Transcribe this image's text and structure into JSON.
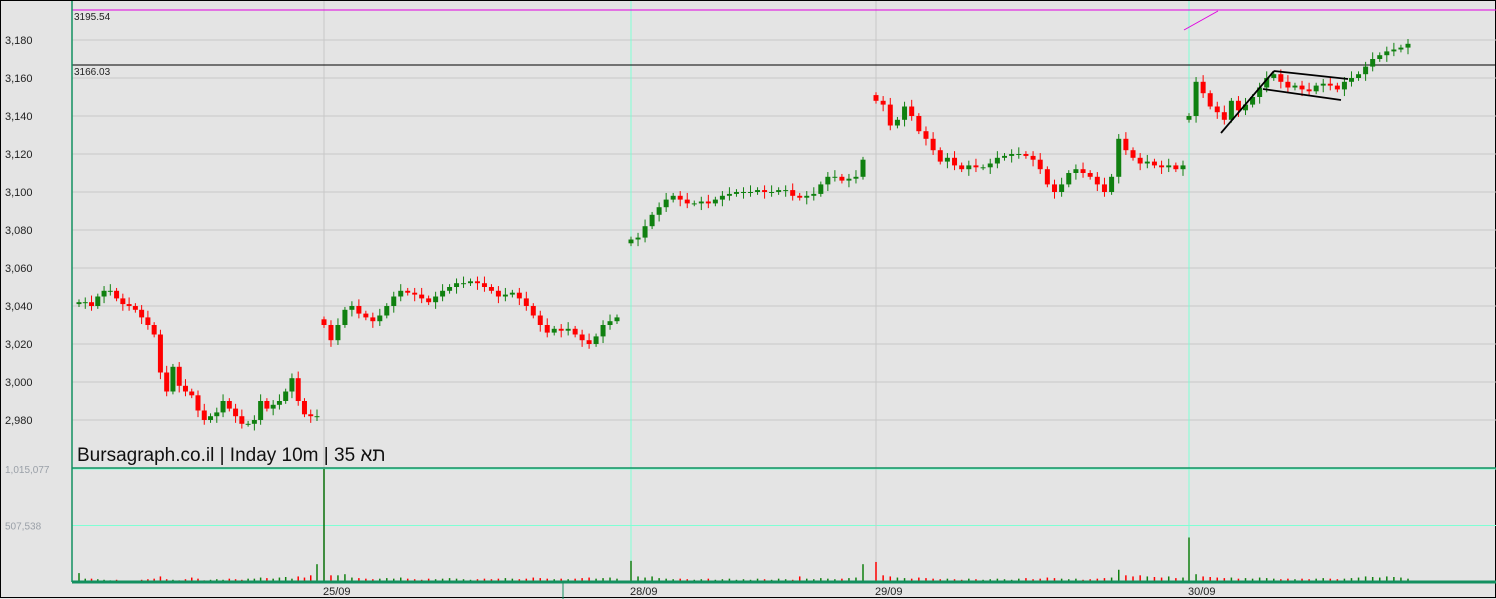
{
  "chart_data": {
    "type": "candlestick",
    "title": "Bursagraph.co.il | Inday 10m | 35 תא",
    "y_ticks": [
      2980,
      3000,
      3020,
      3040,
      3060,
      3080,
      3100,
      3120,
      3140,
      3160,
      3180
    ],
    "y_tick_labels": [
      "2,980",
      "3,000",
      "3,020",
      "3,040",
      "3,060",
      "3,080",
      "3,100",
      "3,120",
      "3,140",
      "3,160",
      "3,180"
    ],
    "ylim": [
      2970,
      3198
    ],
    "levels": [
      {
        "value": 3195.54,
        "label": "3195.54",
        "color": "#e000e0"
      },
      {
        "value": 3166.03,
        "label": "3166.03",
        "color": "#000000"
      }
    ],
    "volume_ticks": [
      {
        "value": 1015077,
        "label": "1,015,077"
      },
      {
        "value": 507538,
        "label": "507,538"
      }
    ],
    "volume_max": 1015077,
    "colors": {
      "up": "#108010",
      "down": "#ff0000",
      "grid": "#c8c8c8",
      "cyan": "#7fffd4",
      "axis": "#139060"
    },
    "days": [
      {
        "label": "",
        "closes": [
          3042,
          3042,
          3040,
          3045,
          3048,
          3048,
          3044,
          3041,
          3040,
          3038,
          3034,
          3030,
          3025,
          3005,
          2995,
          3008,
          2998,
          2995,
          2993,
          2985,
          2980,
          2982,
          2984,
          2990,
          2986,
          2982,
          2978,
          2978,
          2980,
          2990,
          2986,
          2988,
          2990,
          2995,
          3002,
          2990,
          2983,
          2982,
          2982
        ],
        "volumes": [
          80000,
          30000,
          30000,
          25000,
          20000,
          15000,
          20000,
          12000,
          10000,
          12000,
          20000,
          25000,
          30000,
          50000,
          25000,
          20000,
          15000,
          25000,
          40000,
          30000,
          15000,
          20000,
          25000,
          20000,
          30000,
          25000,
          20000,
          30000,
          30000,
          40000,
          35000,
          30000,
          40000,
          45000,
          30000,
          50000,
          40000,
          60000,
          160000
        ]
      },
      {
        "label": "25/09",
        "closes": [
          3030,
          3022,
          3030,
          3038,
          3040,
          3036,
          3034,
          3032,
          3035,
          3040,
          3045,
          3048,
          3047,
          3046,
          3044,
          3042,
          3045,
          3048,
          3050,
          3052,
          3052,
          3053,
          3052,
          3050,
          3048,
          3045,
          3046,
          3047,
          3044,
          3040,
          3035,
          3030,
          3026,
          3028,
          3027,
          3028,
          3025,
          3022,
          3020,
          3024,
          3030,
          3032,
          3034
        ],
        "volumes": [
          1015077,
          60000,
          60000,
          70000,
          40000,
          35000,
          30000,
          25000,
          30000,
          35000,
          30000,
          40000,
          30000,
          25000,
          20000,
          30000,
          25000,
          30000,
          35000,
          30000,
          25000,
          20000,
          25000,
          30000,
          25000,
          30000,
          35000,
          30000,
          25000,
          30000,
          40000,
          35000,
          30000,
          25000,
          30000,
          25000,
          30000,
          35000,
          40000,
          30000,
          35000,
          40000,
          30000
        ]
      },
      {
        "label": "28/09",
        "closes": [
          3075,
          3076,
          3082,
          3088,
          3092,
          3096,
          3098,
          3096,
          3094,
          3094,
          3095,
          3094,
          3096,
          3098,
          3099,
          3100,
          3100,
          3100,
          3101,
          3100,
          3100,
          3101,
          3101,
          3098,
          3097,
          3098,
          3099,
          3104,
          3108,
          3108,
          3106,
          3107,
          3108,
          3117
        ],
        "volumes": [
          190000,
          50000,
          40000,
          50000,
          35000,
          30000,
          25000,
          30000,
          25000,
          20000,
          25000,
          30000,
          20000,
          25000,
          30000,
          20000,
          25000,
          20000,
          30000,
          25000,
          20000,
          30000,
          25000,
          20000,
          50000,
          30000,
          25000,
          35000,
          30000,
          25000,
          30000,
          35000,
          40000,
          160000
        ]
      },
      {
        "label": "29/09",
        "closes": [
          3148,
          3146,
          3135,
          3138,
          3145,
          3140,
          3132,
          3128,
          3122,
          3116,
          3118,
          3114,
          3112,
          3114,
          3113,
          3113,
          3115,
          3118,
          3119,
          3120,
          3120,
          3119,
          3117,
          3112,
          3104,
          3100,
          3104,
          3110,
          3112,
          3110,
          3108,
          3104,
          3100,
          3108,
          3128,
          3122,
          3118,
          3115,
          3116,
          3114,
          3113,
          3114,
          3112,
          3114
        ],
        "volumes": [
          180000,
          60000,
          50000,
          40000,
          35000,
          30000,
          40000,
          35000,
          30000,
          25000,
          30000,
          25000,
          20000,
          30000,
          25000,
          20000,
          25000,
          30000,
          25000,
          20000,
          30000,
          35000,
          25000,
          30000,
          40000,
          35000,
          30000,
          25000,
          30000,
          20000,
          25000,
          30000,
          35000,
          40000,
          110000,
          60000,
          50000,
          60000,
          50000,
          45000,
          40000,
          50000,
          35000,
          40000
        ]
      },
      {
        "label": "30/09",
        "closes": [
          3140,
          3158,
          3152,
          3145,
          3142,
          3138,
          3148,
          3143,
          3146,
          3150,
          3155,
          3160,
          3162,
          3158,
          3155,
          3156,
          3154,
          3153,
          3156,
          3157,
          3156,
          3154,
          3158,
          3160,
          3162,
          3166,
          3170,
          3172,
          3174,
          3175,
          3176,
          3178
        ],
        "volumes": [
          400000,
          70000,
          50000,
          45000,
          40000,
          35000,
          40000,
          30000,
          35000,
          30000,
          40000,
          35000,
          30000,
          25000,
          30000,
          25000,
          30000,
          25000,
          30000,
          35000,
          30000,
          25000,
          30000,
          35000,
          40000,
          50000,
          45000,
          40000,
          50000,
          45000,
          40000,
          30000
        ]
      }
    ]
  }
}
